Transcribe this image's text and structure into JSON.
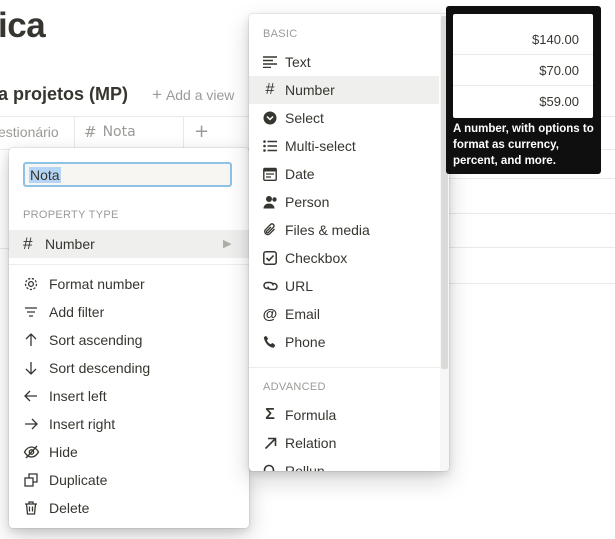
{
  "page": {
    "title": "ica",
    "view_title": "a projetos (MP)",
    "add_view": "Add a view",
    "columns": [
      "estionário",
      "Nota"
    ]
  },
  "property_menu": {
    "name_value": "Nota",
    "section_label": "PROPERTY TYPE",
    "type_label": "Number",
    "items": [
      {
        "label": "Format number",
        "icon": "gear-icon"
      },
      {
        "label": "Add filter",
        "icon": "filter-icon"
      },
      {
        "label": "Sort ascending",
        "icon": "arrow-up-icon"
      },
      {
        "label": "Sort descending",
        "icon": "arrow-down-icon"
      },
      {
        "label": "Insert left",
        "icon": "arrow-left-icon"
      },
      {
        "label": "Insert right",
        "icon": "arrow-right-icon"
      },
      {
        "label": "Hide",
        "icon": "eye-off-icon"
      },
      {
        "label": "Duplicate",
        "icon": "duplicate-icon"
      },
      {
        "label": "Delete",
        "icon": "trash-icon"
      }
    ]
  },
  "type_menu": {
    "basic_label": "BASIC",
    "basic": [
      {
        "label": "Text",
        "icon": "text-icon"
      },
      {
        "label": "Number",
        "icon": "hash-icon"
      },
      {
        "label": "Select",
        "icon": "select-icon"
      },
      {
        "label": "Multi-select",
        "icon": "list-icon"
      },
      {
        "label": "Date",
        "icon": "calendar-icon"
      },
      {
        "label": "Person",
        "icon": "person-icon"
      },
      {
        "label": "Files & media",
        "icon": "paperclip-icon"
      },
      {
        "label": "Checkbox",
        "icon": "checkbox-icon"
      },
      {
        "label": "URL",
        "icon": "link-icon"
      },
      {
        "label": "Email",
        "icon": "at-icon"
      },
      {
        "label": "Phone",
        "icon": "phone-icon"
      }
    ],
    "advanced_label": "ADVANCED",
    "advanced": [
      {
        "label": "Formula",
        "icon": "sigma-icon"
      },
      {
        "label": "Relation",
        "icon": "arrow-up-right-icon"
      },
      {
        "label": "Rollup",
        "icon": "search-icon"
      }
    ],
    "highlighted": "Number"
  },
  "tooltip": {
    "values": [
      "$140.00",
      "$70.00",
      "$59.00"
    ],
    "description": "A number, with options to format as currency, percent, and more."
  }
}
